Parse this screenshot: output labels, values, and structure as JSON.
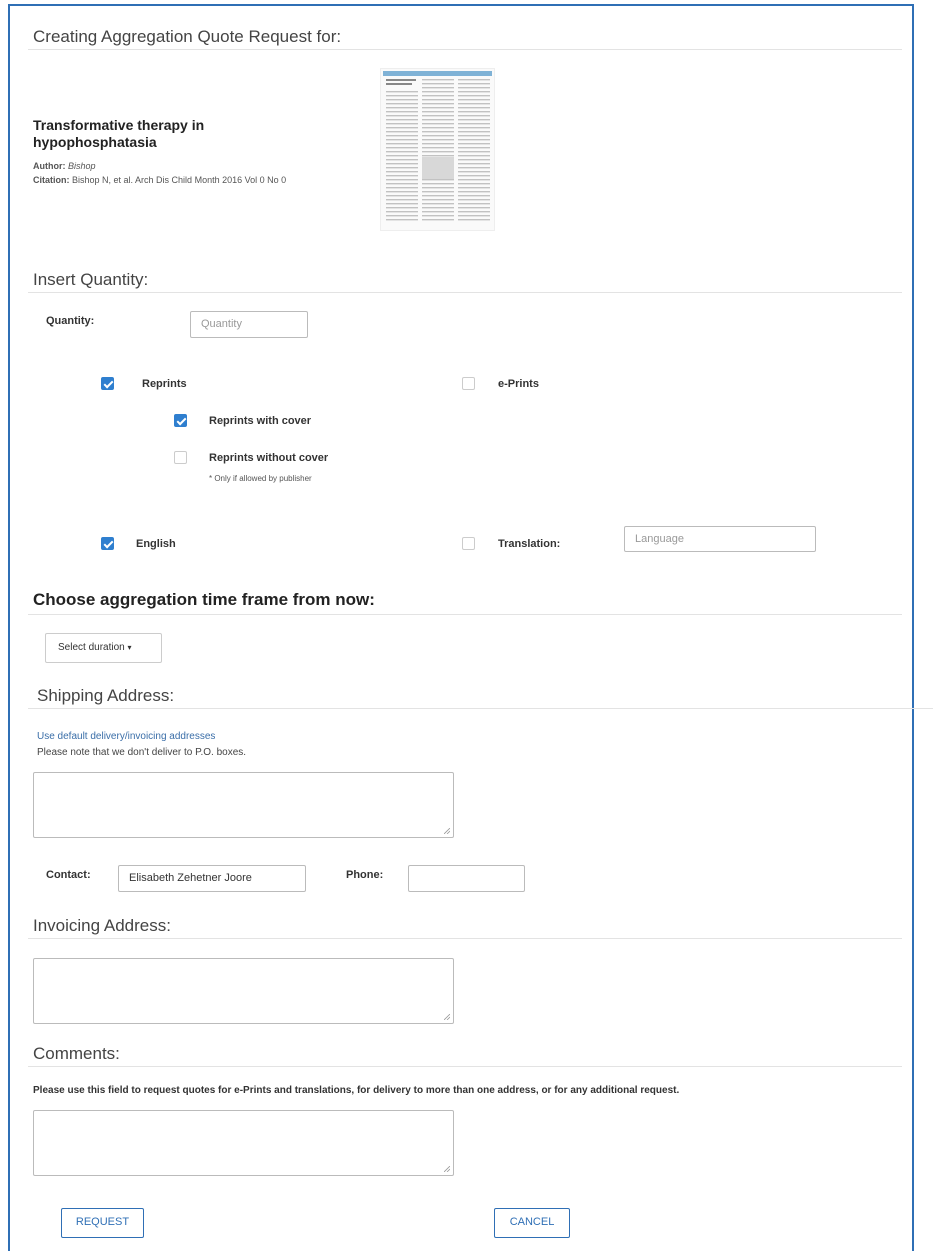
{
  "header": {
    "title": "Creating Aggregation Quote Request for:"
  },
  "article": {
    "title_line1": "Transformative therapy in",
    "title_line2": "hypophosphatasia",
    "author_label": "Author:",
    "author_value": "Bishop",
    "citation_label": "Citation:",
    "citation_value": "Bishop N, et al. Arch Dis Child Month 2016 Vol 0 No 0"
  },
  "quantity": {
    "section_title": "Insert Quantity:",
    "label": "Quantity:",
    "placeholder": "Quantity"
  },
  "options": {
    "reprints": {
      "label": "Reprints",
      "checked": true
    },
    "eprints": {
      "label": "e-Prints",
      "checked": false
    },
    "with_cover": {
      "label": "Reprints with cover",
      "checked": true
    },
    "without_cover": {
      "label": "Reprints without cover",
      "checked": false
    },
    "note": "* Only if allowed by publisher",
    "english": {
      "label": "English",
      "checked": true
    },
    "translation": {
      "label": "Translation:",
      "checked": false
    },
    "language_placeholder": "Language"
  },
  "timeframe": {
    "section_title": "Choose aggregation time frame from now:",
    "dropdown_label": "Select duration"
  },
  "shipping": {
    "section_title": "Shipping Address:",
    "link": "Use default delivery/invoicing addresses",
    "note": "Please note that we don't deliver to P.O. boxes.",
    "contact_label": "Contact:",
    "contact_value": "Elisabeth Zehetner Joore",
    "phone_label": "Phone:",
    "phone_value": ""
  },
  "invoicing": {
    "section_title": "Invoicing Address:"
  },
  "comments": {
    "section_title": "Comments:",
    "instructions": "Please use this field to request quotes for e-Prints and translations, for delivery to more than one address, or for any additional request."
  },
  "actions": {
    "request": "REQUEST",
    "cancel": "CANCEL"
  },
  "colors": {
    "accent": "#2f6fb5",
    "checkbox": "#2f7fcf"
  }
}
